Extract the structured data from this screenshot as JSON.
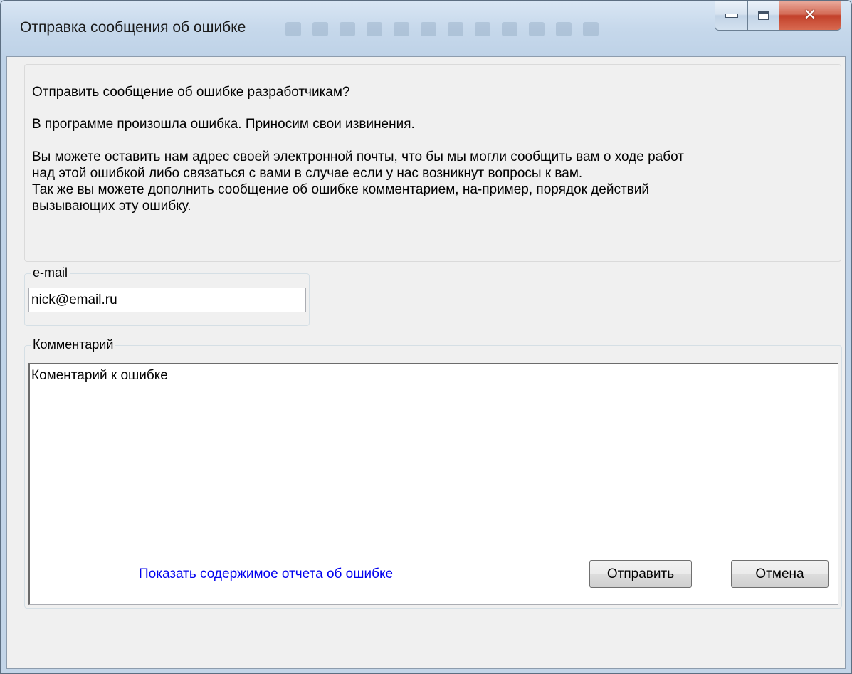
{
  "window": {
    "title": "Отправка сообщения об ошибке"
  },
  "message": {
    "lines": [
      "Отправить сообщение об ошибке разработчикам?",
      "В программе произошла ошибка. Приносим свои извинения.",
      "Вы можете оставить нам адрес своей электронной почты, что бы мы могли сообщить вам о ходе работ",
      "над этой ошибкой либо связаться с вами в случае если у нас возникнут вопросы к вам.",
      "Так же вы можете дополнить сообщение об ошибке комментарием, на-пример, порядок действий",
      "вызывающих эту ошибку."
    ]
  },
  "email": {
    "label": "e-mail",
    "value": "nick@email.ru"
  },
  "comment": {
    "label": "Комментарий",
    "value": "Коментарий к ошибке"
  },
  "footer": {
    "report_link": "Показать содержимое отчета об ошибке",
    "send_label": "Отправить",
    "cancel_label": "Отмена"
  },
  "colors": {
    "link": "#0000ee",
    "close_button": "#c2402a"
  },
  "icons": [
    "minimize-icon",
    "maximize-icon",
    "close-icon"
  ]
}
